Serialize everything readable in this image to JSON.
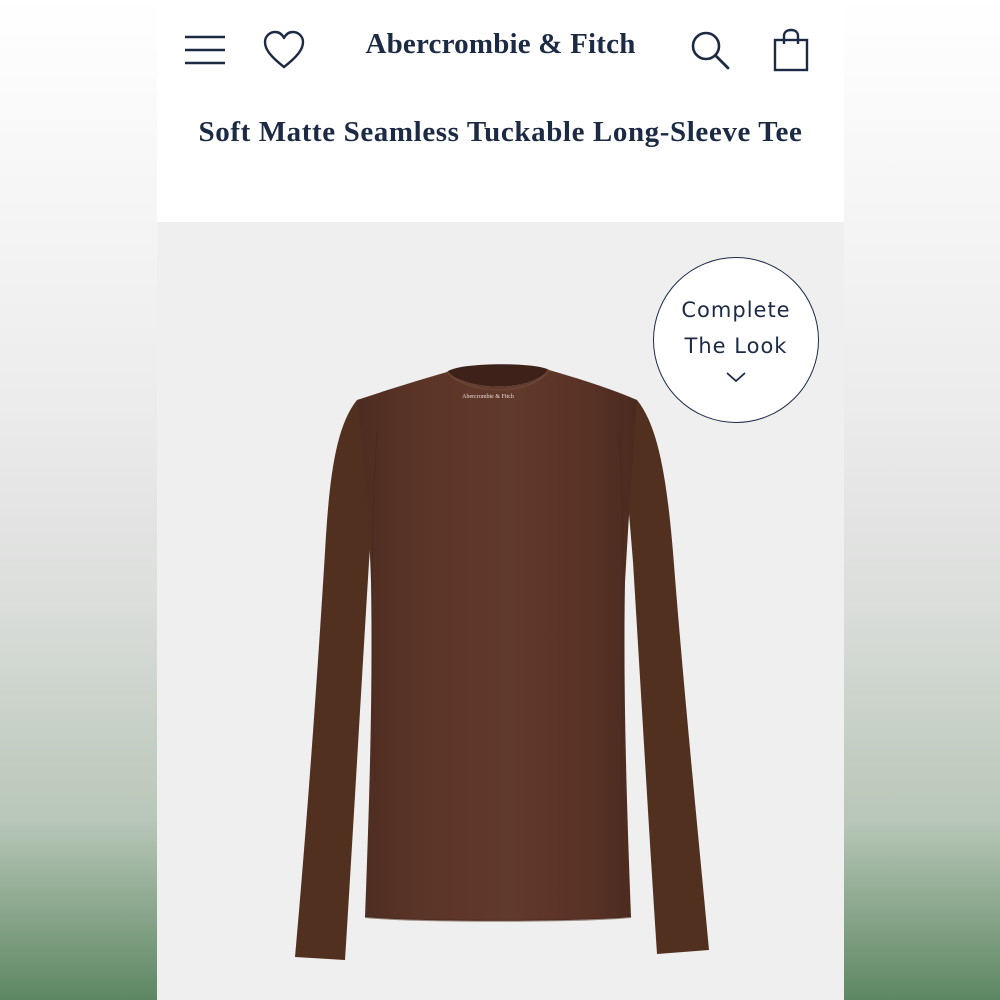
{
  "header": {
    "brand": "Abercrombie & Fitch",
    "menu_icon": "hamburger-menu-icon",
    "wishlist_icon": "heart-icon",
    "search_icon": "search-icon",
    "bag_icon": "shopping-bag-icon"
  },
  "product": {
    "title": "Soft Matte Seamless Tuckable Long-Sleeve Tee",
    "garment_color": "#5a3427",
    "neck_label": "Abercrombie & Fitch"
  },
  "complete_the_look": {
    "line1": "Complete",
    "line2": "The Look",
    "icon": "chevron-down-icon"
  },
  "colors": {
    "navy": "#1c2a44",
    "image_bg": "#efefef"
  }
}
